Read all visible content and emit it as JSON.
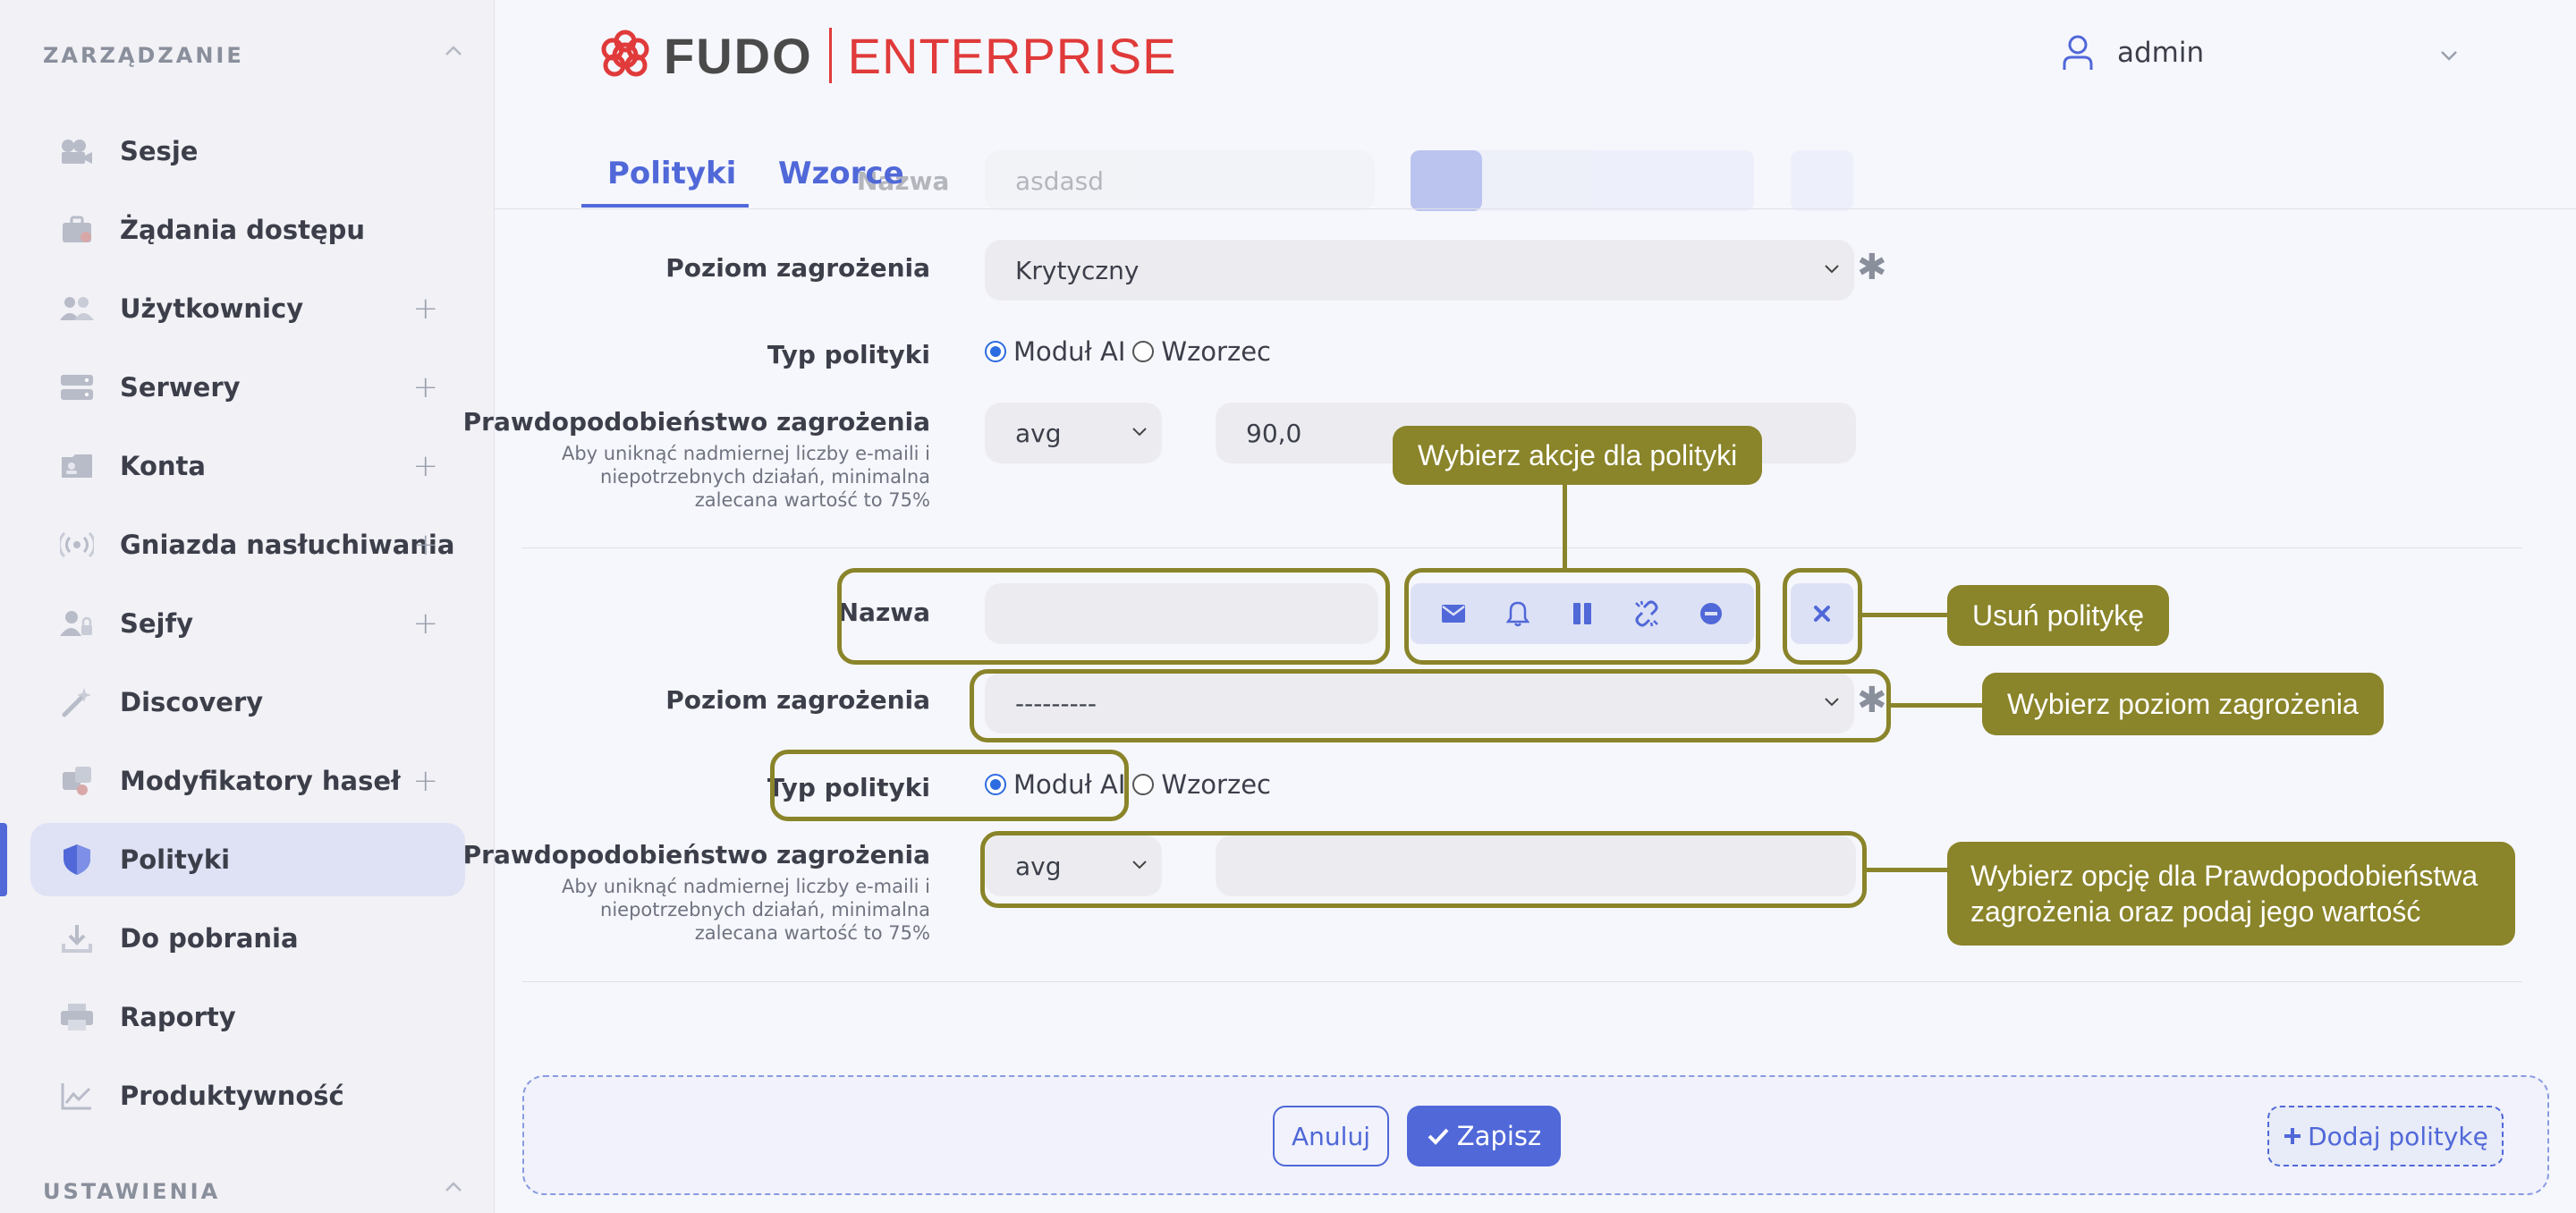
{
  "sidebar": {
    "section_management": "ZARZĄDZANIE",
    "section_settings": "USTAWIENIA",
    "items": [
      {
        "label": "Sesje",
        "icon": "camera-icon"
      },
      {
        "label": "Żądania dostępu",
        "icon": "briefcase-icon"
      },
      {
        "label": "Użytkownicy",
        "icon": "users-icon",
        "expandable": true
      },
      {
        "label": "Serwery",
        "icon": "server-icon",
        "expandable": true
      },
      {
        "label": "Konta",
        "icon": "account-card-icon",
        "expandable": true
      },
      {
        "label": "Gniazda nasłuchiwania",
        "icon": "broadcast-icon",
        "expandable": true
      },
      {
        "label": "Sejfy",
        "icon": "user-lock-icon",
        "expandable": true
      },
      {
        "label": "Discovery",
        "icon": "magic-wand-icon"
      },
      {
        "label": "Modyfikatory haseł",
        "icon": "puzzle-icon",
        "expandable": true
      },
      {
        "label": "Polityki",
        "icon": "shield-icon",
        "active": true
      },
      {
        "label": "Do pobrania",
        "icon": "download-icon"
      },
      {
        "label": "Raporty",
        "icon": "printer-icon"
      },
      {
        "label": "Produktywność",
        "icon": "chart-line-icon"
      }
    ],
    "plus": "+"
  },
  "header": {
    "logo_fudo": "FUDO",
    "logo_enterprise": "ENTERPRISE",
    "user_name": "admin"
  },
  "tabs": [
    {
      "label": "Polityki",
      "active": true
    },
    {
      "label": "Wzorce",
      "active": false
    }
  ],
  "ghost_row": {
    "label": "Nazwa",
    "value": "asdasd"
  },
  "policy1": {
    "threat_level_label": "Poziom zagrożenia",
    "threat_level_value": "Krytyczny",
    "policy_type_label": "Typ polityki",
    "option_ai": "Moduł AI",
    "option_pattern": "Wzorzec",
    "probability_label": "Prawdopodobieństwo zagrożenia",
    "probability_hint": "Aby uniknąć nadmiernej liczby e-maili i niepotrzebnych działań, minimalna zalecana wartość to 75%",
    "aggregate_value": "avg",
    "probability_value": "90,0"
  },
  "policy2": {
    "name_label": "Nazwa",
    "name_value": "",
    "threat_level_label": "Poziom zagrożenia",
    "threat_level_value": "---------",
    "policy_type_label": "Typ polityki",
    "option_ai": "Moduł AI",
    "option_pattern": "Wzorzec",
    "probability_label": "Prawdopodobieństwo zagrożenia",
    "probability_hint": "Aby uniknąć nadmiernej liczby e-maili i niepotrzebnych działań, minimalna zalecana wartość to 75%",
    "aggregate_value": "avg",
    "probability_value": ""
  },
  "actions": [
    "envelope-icon",
    "bell-icon",
    "pause-icon",
    "unlink-icon",
    "minus-circle-icon"
  ],
  "callouts": {
    "actions": "Wybierz akcje dla polityki",
    "delete": "Usuń politykę",
    "threat_level": "Wybierz poziom zagrożenia",
    "probability": "Wybierz opcję dla Prawdopodobieństwa zagrożenia oraz podaj jego wartość"
  },
  "footer": {
    "cancel": "Anuluj",
    "save": "Zapisz",
    "add_policy": "Dodaj politykę"
  },
  "colors": {
    "accent": "#5068d8",
    "highlight": "#8a842a",
    "brand_red": "#e03a3a"
  }
}
